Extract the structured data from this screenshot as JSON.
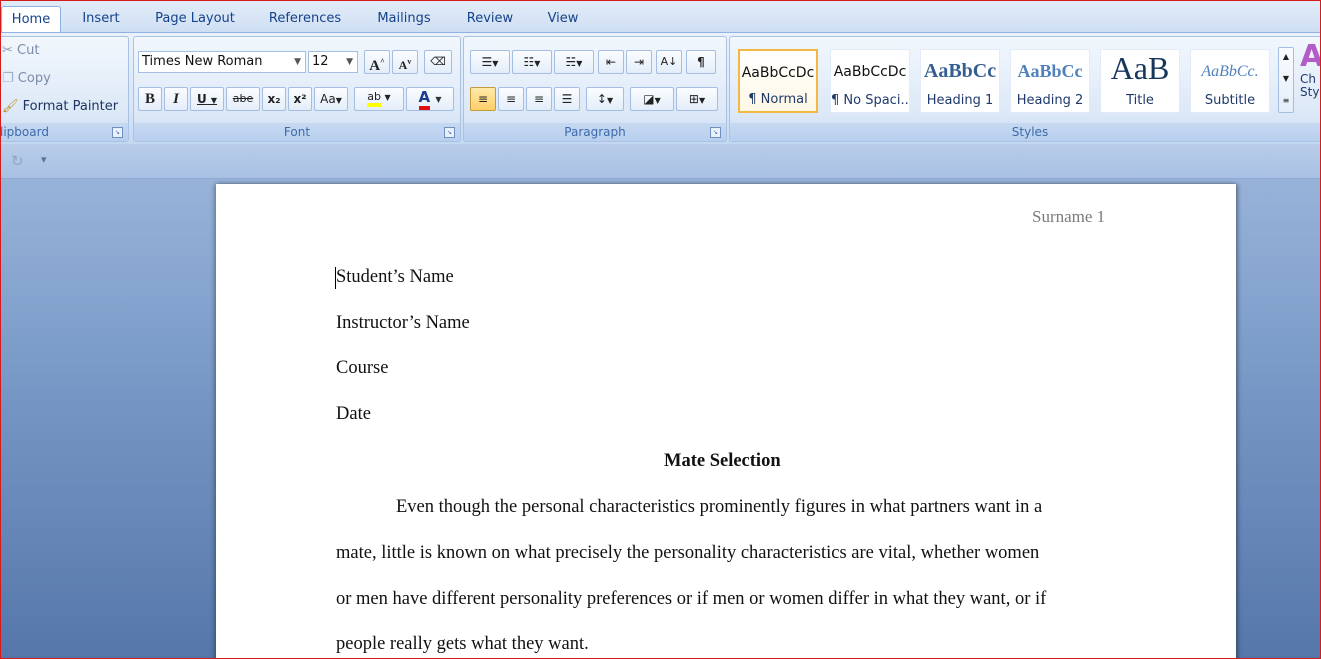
{
  "tabs": [
    "Home",
    "Insert",
    "Page Layout",
    "References",
    "Mailings",
    "Review",
    "View"
  ],
  "clipboard": {
    "cut": "Cut",
    "copy": "Copy",
    "format_painter": "Format Painter",
    "label": "lipboard"
  },
  "font": {
    "family": "Times New Roman",
    "size": "12",
    "label": "Font",
    "bold": "B",
    "italic": "I",
    "underline": "U",
    "strike": "abe",
    "subscript": "x₂",
    "superscript": "x²",
    "change_case": "Aa",
    "grow": "A",
    "shrink": "A",
    "highlight": "ab",
    "font_color": "A"
  },
  "paragraph": {
    "label": "Paragraph"
  },
  "styles": {
    "label": "Styles",
    "tiles": [
      {
        "sample": "AaBbCcDc",
        "name": "¶ Normal"
      },
      {
        "sample": "AaBbCcDc",
        "name": "¶ No Spaci..."
      },
      {
        "sample": "AaBbCc",
        "name": "Heading 1"
      },
      {
        "sample": "AaBbCc",
        "name": "Heading 2"
      },
      {
        "sample": "AaB",
        "name": "Title"
      },
      {
        "sample": "AaBbCc.",
        "name": "Subtitle"
      }
    ],
    "change_styles": "Ch Sty"
  },
  "colors": {
    "accent": "#15428b",
    "highlight": "#ffff00",
    "font_red": "#e01010",
    "selected_style": "#f2b842"
  },
  "document": {
    "header": "Surname 1",
    "lines": [
      "Student’s Name",
      "Instructor’s Name",
      "Course",
      "Date"
    ],
    "title": "Mate Selection",
    "body": [
      "Even though the personal characteristics prominently figures in what partners want in a",
      "mate, little is known on what precisely the personality characteristics are vital, whether women",
      "or men have different personality preferences or if men or women differ in what they want, or if",
      "people really gets what they want."
    ]
  }
}
